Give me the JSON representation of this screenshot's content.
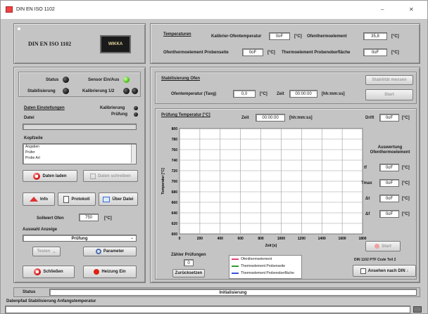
{
  "window": {
    "title": "DIN EN ISO 1102",
    "controls": {
      "minimize": "–",
      "close": "✕"
    }
  },
  "header": {
    "standard": "DIN EN ISO 1102",
    "logo_text": "WIKKA",
    "temps_title": "Temperaturen",
    "temps": [
      {
        "label": "Kalibrier-Ofentemperatur",
        "value": "0oF",
        "unit": "[°C]"
      },
      {
        "label": "Ofenthermoelement",
        "value": "35,8",
        "unit": "[°C]"
      },
      {
        "label": "Ofenthermoelement Probenseite",
        "value": "0oF",
        "unit": "[°C]"
      },
      {
        "label": "Thermoelement Probenoberfläche",
        "value": "0oF",
        "unit": "[°C]"
      }
    ]
  },
  "status_panel": {
    "status_label": "Status",
    "sensor_label": "Sensor Ein/Aus",
    "stabilize_label": "Stabilisierung",
    "calibration_label": "Kalibrierung 1/2",
    "test_settings_title": "Daten Einstellungen",
    "calibration_item": "Kalibrierung",
    "test_item": "Prüfung",
    "test_field_label": "Datei",
    "test_field_value": "",
    "material_label": "Kopfzeile",
    "material_lines": [
      "Angaben",
      "Prüfer",
      "Probe Art"
    ],
    "save_data_button": "Daten laden",
    "request_button": "Daten schreiben",
    "info_button": "Info",
    "protocol_button": "Protokoll",
    "open_button": "Über Datei",
    "setpoint_label": "Sollwert Ofen",
    "setpoint_value": "750",
    "setpoint_unit": "[°C]",
    "display_label": "Auswahl Anzeige",
    "display_value": "Prüfung",
    "test_button": "Testen",
    "parameters_button": "Parameter",
    "close_button": "Schließen",
    "heating_button": "Heizung Ein"
  },
  "stabilization": {
    "title": "Stabilisierung Ofen",
    "temp_label": "Ofentemperatur (Tavg)",
    "temp_value": "0,0",
    "temp_unit": "[°C]",
    "time_label": "Zeit",
    "time_value": "00:00:00",
    "time_unit": "[hh:mm:ss]",
    "start_button": "Stabilität messen",
    "stop_button": "Start"
  },
  "test": {
    "title": "Prüfung Temperatur [°C]",
    "time_label": "Zeit",
    "time_value": "00:00:00",
    "time_unit": "[hh:mm:ss]",
    "drift_label": "Drift",
    "drift_value": "0oF",
    "drift_unit": "[°C]",
    "eval_title": "Auswertung Ofenthermoelement",
    "eval_rows": [
      {
        "label": "tf",
        "value": "0oF",
        "unit": "[°C]"
      },
      {
        "label": "Tmax",
        "value": "0oF",
        "unit": "[°C]"
      },
      {
        "label": "Δt",
        "value": "0oF",
        "unit": "[°C]"
      },
      {
        "label": "Δf",
        "value": "0oF",
        "unit": "[°C]"
      }
    ],
    "count_label": "Zähler Prüfungen",
    "count_value": "0",
    "reset_button": "Zurücksetzen",
    "legend": [
      {
        "label": "Ofenthermoelement",
        "color": "#e0457a"
      },
      {
        "label": "Thermoelement Probenseite",
        "color": "#2e9b3a"
      },
      {
        "label": "Thermoelement Probenoberfläche",
        "color": "#3850d8"
      }
    ],
    "stop_button": "Start",
    "rev_text": "DIN 1102 PTF Code Teil 2",
    "transfer_button": "Ansehen nach DIN ↓"
  },
  "chart_data": {
    "type": "line",
    "title": "",
    "xlabel": "Zeit [s]",
    "ylabel": "Temperatur [°C]",
    "xlim": [
      0,
      1800
    ],
    "ylim": [
      600,
      800
    ],
    "xticks": [
      0,
      200,
      400,
      600,
      800,
      1000,
      1200,
      1400,
      1600,
      1800
    ],
    "yticks": [
      600,
      620,
      640,
      660,
      680,
      700,
      720,
      740,
      760,
      780,
      800
    ],
    "grid": true,
    "series": []
  },
  "statusbar": {
    "status_label": "Status",
    "status_value": "Initialisierung",
    "note": "Datenpfad Stabilisierung Anfangstemperatur",
    "path_value": ""
  }
}
